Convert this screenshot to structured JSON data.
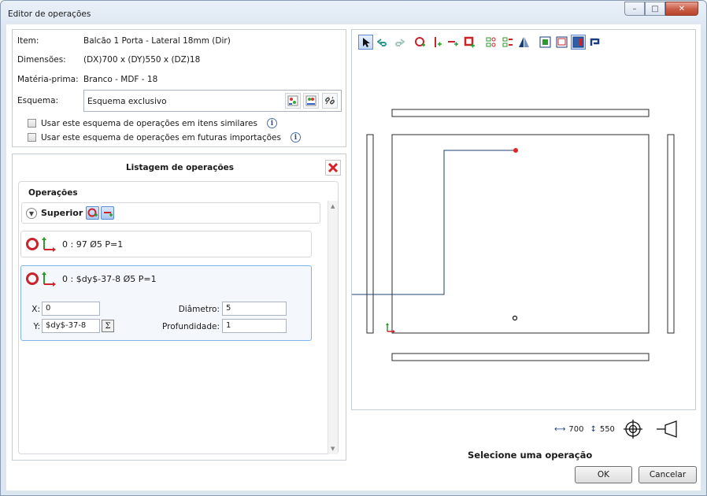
{
  "window": {
    "title": "Editor de operações",
    "minimize": "–",
    "maximize": "□",
    "close": "✕"
  },
  "item_panel": {
    "item_label": "Item:",
    "item_value": "Balcão 1 Porta - Lateral 18mm (Dir)",
    "dims_label": "Dimensões:",
    "dims_value": "(DX)700 x (DY)550 x (DZ)18",
    "material_label": "Matéria-prima:",
    "material_value": "Branco - MDF - 18",
    "schema_label": "Esquema:",
    "schema_value": "Esquema exclusivo",
    "checkbox_similar": "Usar este esquema de operações em itens similares",
    "checkbox_future": "Usar este esquema de operações em futuras importações",
    "info_glyph": "i"
  },
  "operations": {
    "title": "Listagem de operações",
    "group_label": "Operações",
    "face_label": "Superior",
    "items": [
      {
        "text": "0 : 97 Ø5 P=1"
      },
      {
        "text": "0 : $dy$-37-8 Ø5 P=1"
      }
    ],
    "selected": {
      "x_label": "X:",
      "x_value": "0",
      "y_label": "Y:",
      "y_value": "$dy$-37-8",
      "diameter_label": "Diâmetro:",
      "diameter_value": "5",
      "depth_label": "Profundidade:",
      "depth_value": "1",
      "sigma": "Σ"
    }
  },
  "canvas": {
    "width_value": "700",
    "height_value": "550",
    "status": "Selecione uma operação",
    "colors": {
      "drawing": "#2b2b2b",
      "selected_point": "#e0242b",
      "leader": "#1f3f74"
    }
  },
  "buttons": {
    "ok": "OK",
    "cancel": "Cancelar"
  }
}
